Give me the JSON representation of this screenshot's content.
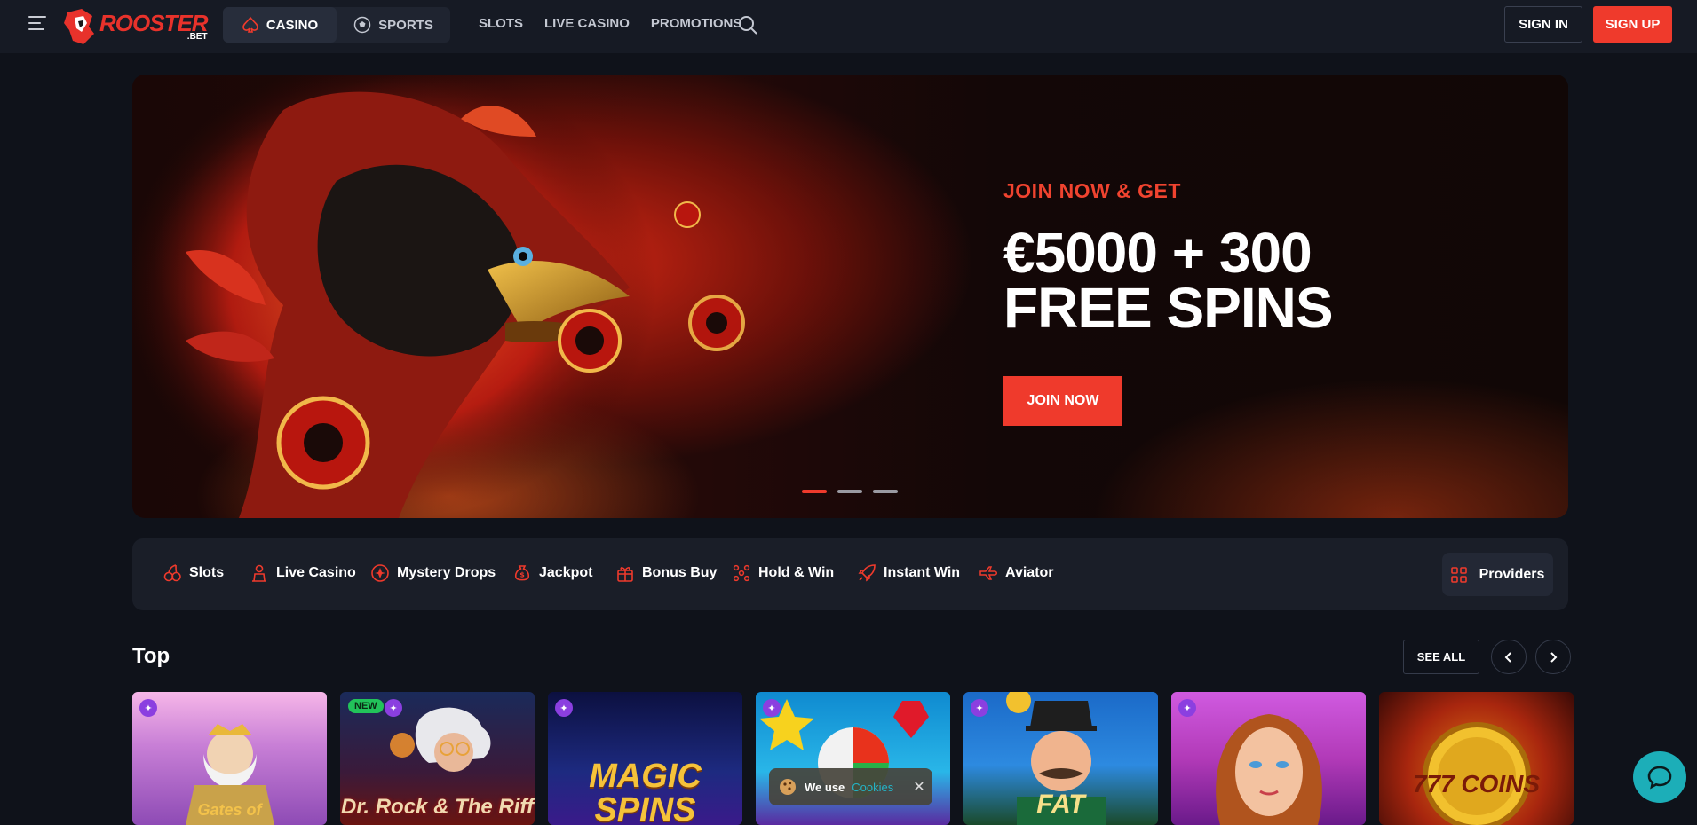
{
  "header": {
    "logo_name": "ROOSTER",
    "logo_sub": ".BET",
    "toggle": {
      "casino": "CASINO",
      "sports": "SPORTS"
    },
    "nav": [
      "SLOTS",
      "LIVE CASINO",
      "PROMOTIONS"
    ],
    "sign_in": "SIGN IN",
    "sign_up": "SIGN UP"
  },
  "hero": {
    "kicker": "JOIN NOW & GET",
    "title_line1": "€5000 + 300",
    "title_line2": "FREE SPINS",
    "cta": "JOIN NOW",
    "slides": 3,
    "active_slide": 1
  },
  "categories": {
    "items": [
      "Slots",
      "Live Casino",
      "Mystery Drops",
      "Jackpot",
      "Bonus Buy",
      "Hold & Win",
      "Instant Win",
      "Aviator"
    ],
    "providers": "Providers"
  },
  "top": {
    "title": "Top",
    "see_all": "SEE ALL",
    "games": [
      {
        "title": "Gates of",
        "badge_new": ""
      },
      {
        "title": "Dr. Rock & The Riff",
        "badge_new": "NEW"
      },
      {
        "title": "MAGIC SPINS",
        "badge_new": ""
      },
      {
        "title": "",
        "badge_new": ""
      },
      {
        "title": "FAT",
        "badge_new": ""
      },
      {
        "title": "",
        "badge_new": ""
      },
      {
        "title": "777 COINS",
        "badge_new": ""
      }
    ]
  },
  "cookie": {
    "text": "We use",
    "link": "Cookies"
  },
  "colors": {
    "accent": "#ef3a2c",
    "bg": "#0f121a",
    "header": "#161a24",
    "panel": "#1a1e28",
    "chat": "#1caeb8"
  }
}
